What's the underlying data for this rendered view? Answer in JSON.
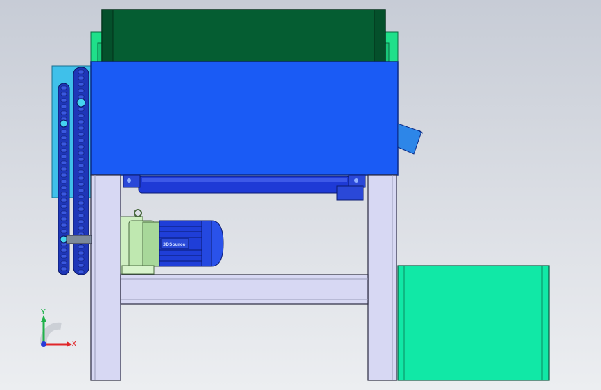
{
  "viewport": {
    "background": "#d5d9e0"
  },
  "model": {
    "hopper_color": "#055d32",
    "hopper_frame_color": "#1fe08a",
    "housing_color": "#1a5bf5",
    "frame_leg_color": "#d7d8f3",
    "chain_color": "#1e36b8",
    "chain_guard_color": "#3fc0ea",
    "roller_color": "#1e3ad6",
    "motor_color": "#1f3ed8",
    "gearbox_color": "#cfefc2",
    "bin_color": "#11e8a6",
    "motor_label": "3DSource"
  },
  "triad": {
    "x_label": "X",
    "y_label": "Y",
    "x_color": "#e0262a",
    "y_color": "#20b24a"
  }
}
